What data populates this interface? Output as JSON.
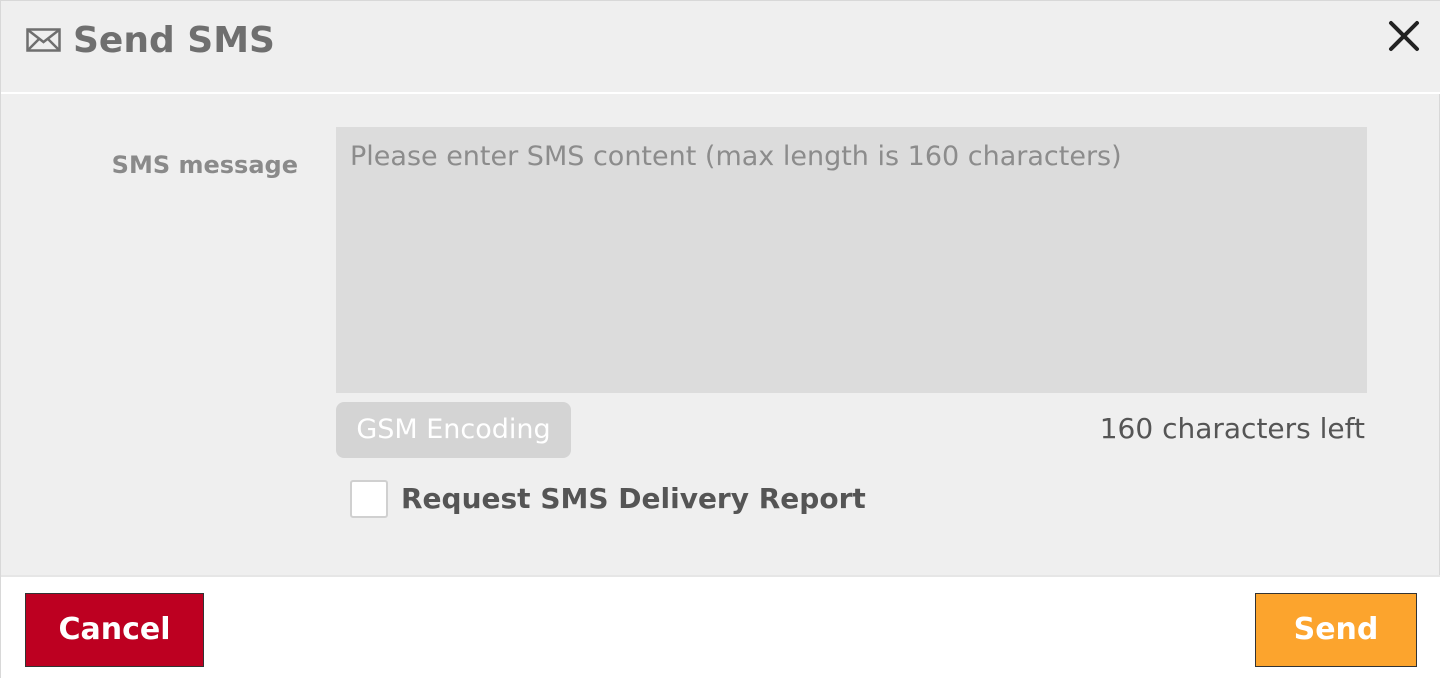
{
  "dialog": {
    "title": "Send SMS",
    "title_icon": "envelope-icon",
    "close_icon": "close-icon"
  },
  "form": {
    "message_label": "SMS message",
    "message_value": "",
    "message_placeholder": "Please enter SMS content (max length is 160 characters)",
    "encoding_label": "GSM Encoding",
    "chars_left": "160 characters left",
    "delivery_report_label": "Request SMS Delivery Report",
    "delivery_report_checked": false
  },
  "footer": {
    "cancel_label": "Cancel",
    "send_label": "Send"
  },
  "colors": {
    "cancel": "#bd0021",
    "send": "#fca42d",
    "background": "#efefef"
  }
}
